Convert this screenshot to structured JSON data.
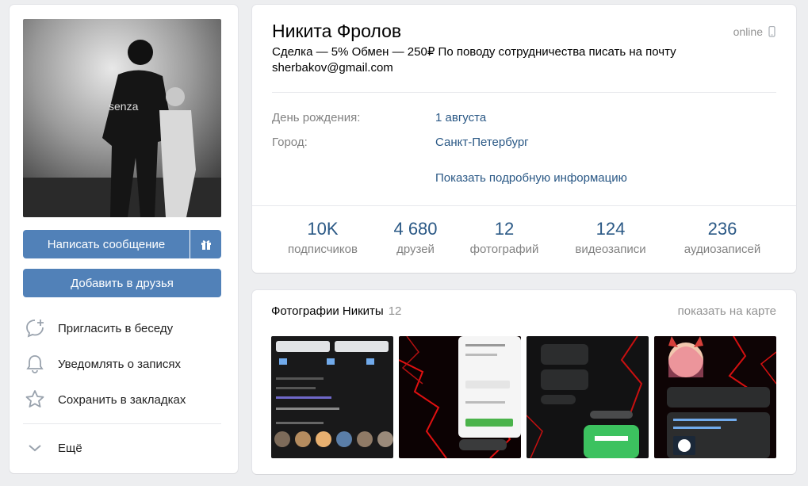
{
  "left": {
    "send_message": "Написать сообщение",
    "add_friend": "Добавить в друзья",
    "actions": [
      {
        "label": "Пригласить в беседу",
        "icon": "chat-plus-icon"
      },
      {
        "label": "Уведомлять о записях",
        "icon": "bell-icon"
      },
      {
        "label": "Сохранить в закладках",
        "icon": "star-icon"
      }
    ],
    "more": "Ещё"
  },
  "profile": {
    "name": "Никита Фролов",
    "online": "online",
    "status": "Сделка — 5% Обмен — 250₽ По поводу сотрудничества писать на почту sherbakov@gmail.com",
    "info": [
      {
        "label": "День рождения:",
        "value": "1 августа"
      },
      {
        "label": "Город:",
        "value": "Санкт-Петербург"
      }
    ],
    "show_more": "Показать подробную информацию",
    "stats": [
      {
        "n": "10K",
        "t": "подписчиков"
      },
      {
        "n": "4 680",
        "t": "друзей"
      },
      {
        "n": "12",
        "t": "фотографий"
      },
      {
        "n": "124",
        "t": "видеозаписи"
      },
      {
        "n": "236",
        "t": "аудиозаписей"
      }
    ]
  },
  "photos": {
    "title": "Фотографии Никиты",
    "count": "12",
    "map_link": "показать на карте"
  },
  "colors": {
    "accent": "#5181b8",
    "link": "#2a5885",
    "muted": "#828282"
  }
}
